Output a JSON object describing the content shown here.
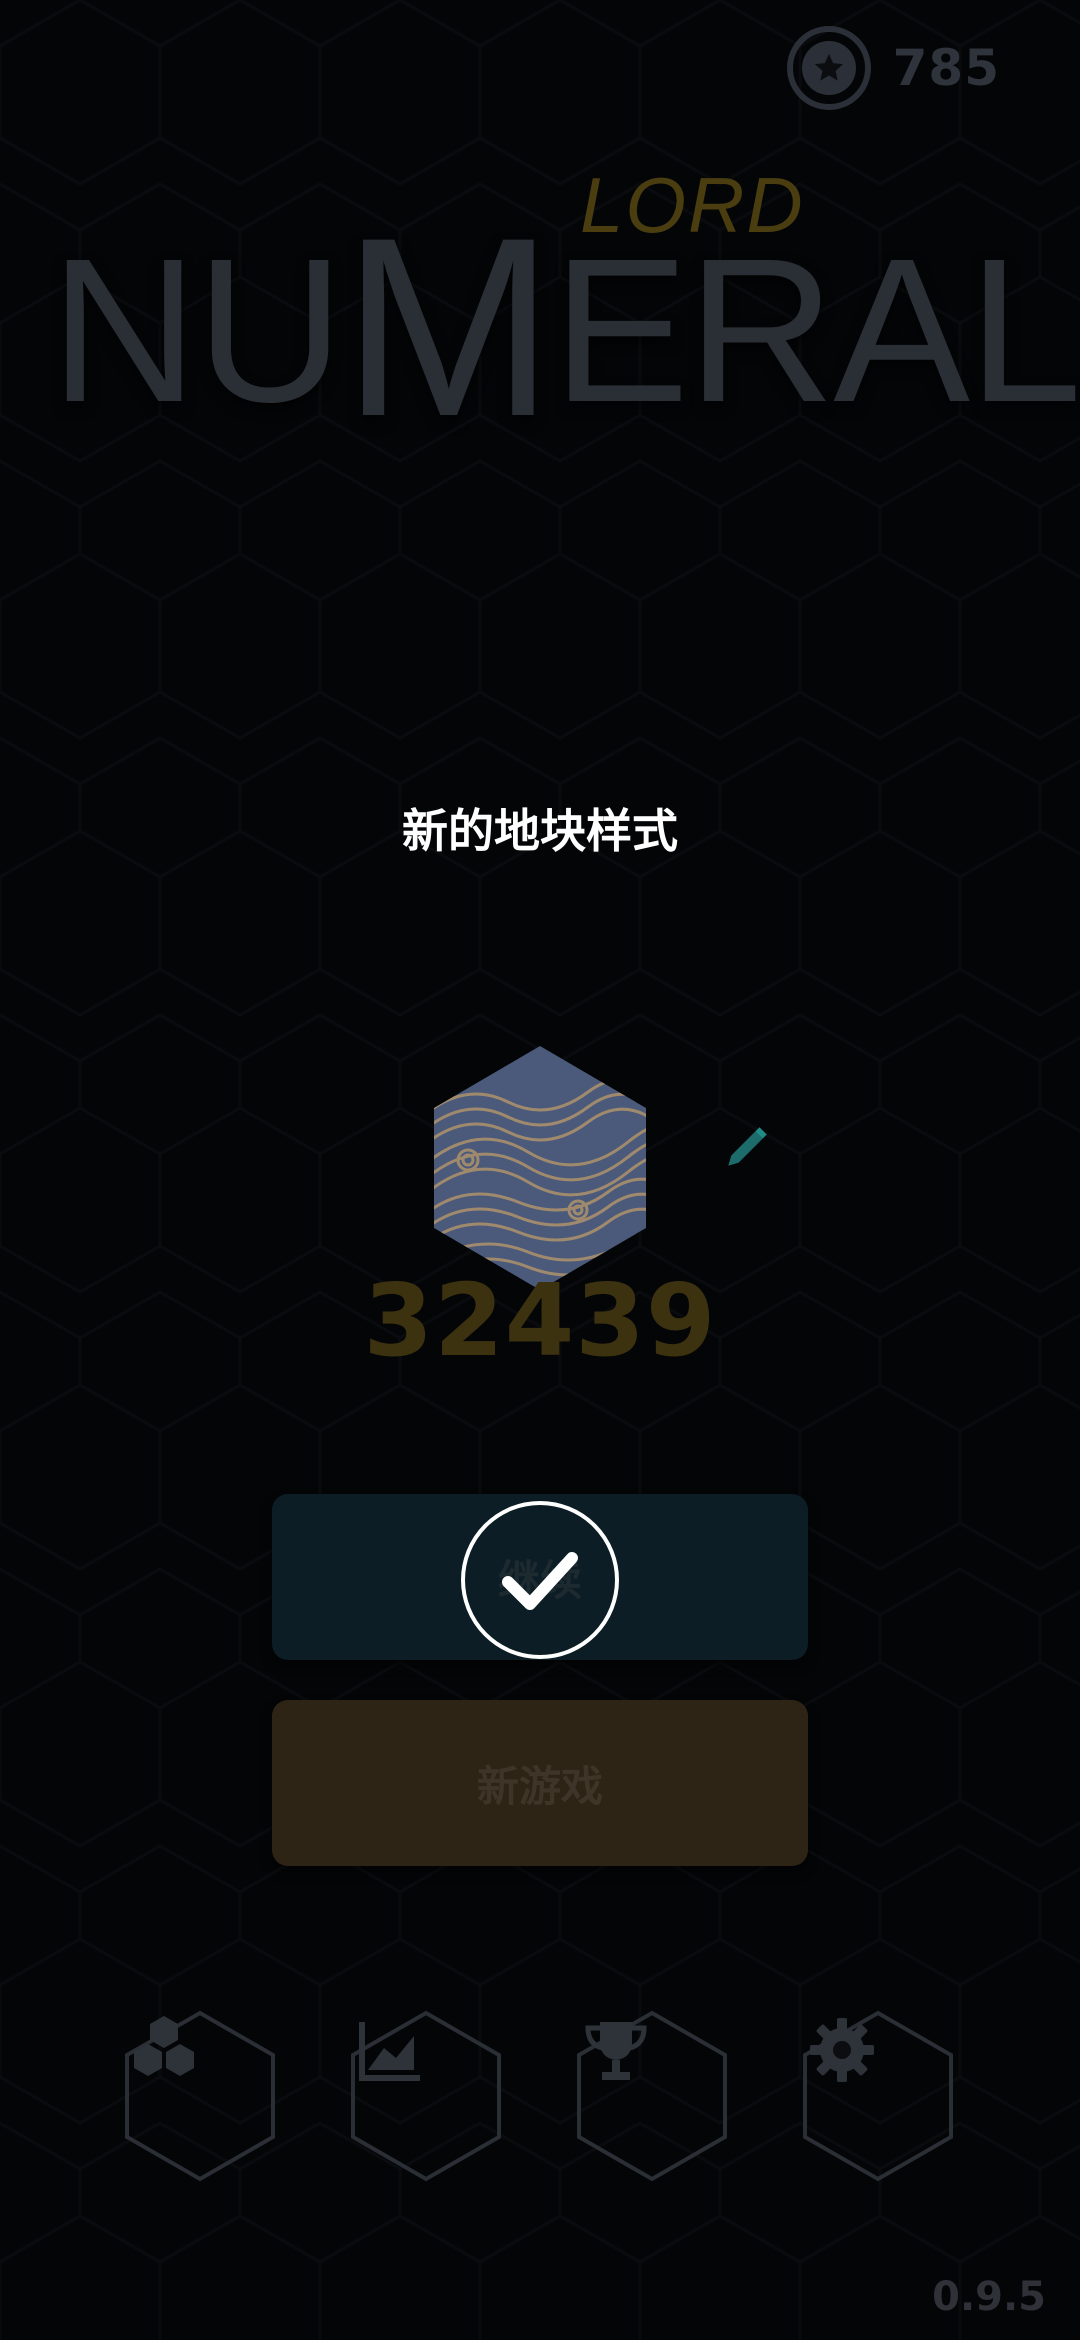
{
  "header": {
    "coins": "785",
    "coin_icon": "star-coin-icon"
  },
  "logo": {
    "main_left": "NU",
    "main_m": "M",
    "main_right": "ERAL",
    "sub": "LORD"
  },
  "popup": {
    "title": "新的地块样式",
    "tile_style_icon": "wave-pattern-hex-tile",
    "score": "32439",
    "confirm_icon": "checkmark-icon"
  },
  "buttons": {
    "continue_label": "继续",
    "new_game_label": "新游戏"
  },
  "nav": {
    "items": [
      {
        "icon": "hex-tiles-icon"
      },
      {
        "icon": "stats-chart-icon"
      },
      {
        "icon": "trophy-icon"
      },
      {
        "icon": "gear-icon"
      }
    ]
  },
  "footer": {
    "version": "0.9.5"
  },
  "colors": {
    "background": "#0b0d10",
    "continue_button": "#0c1d25",
    "new_game_button": "#2e2416",
    "accent_gold": "#4a3d10"
  }
}
